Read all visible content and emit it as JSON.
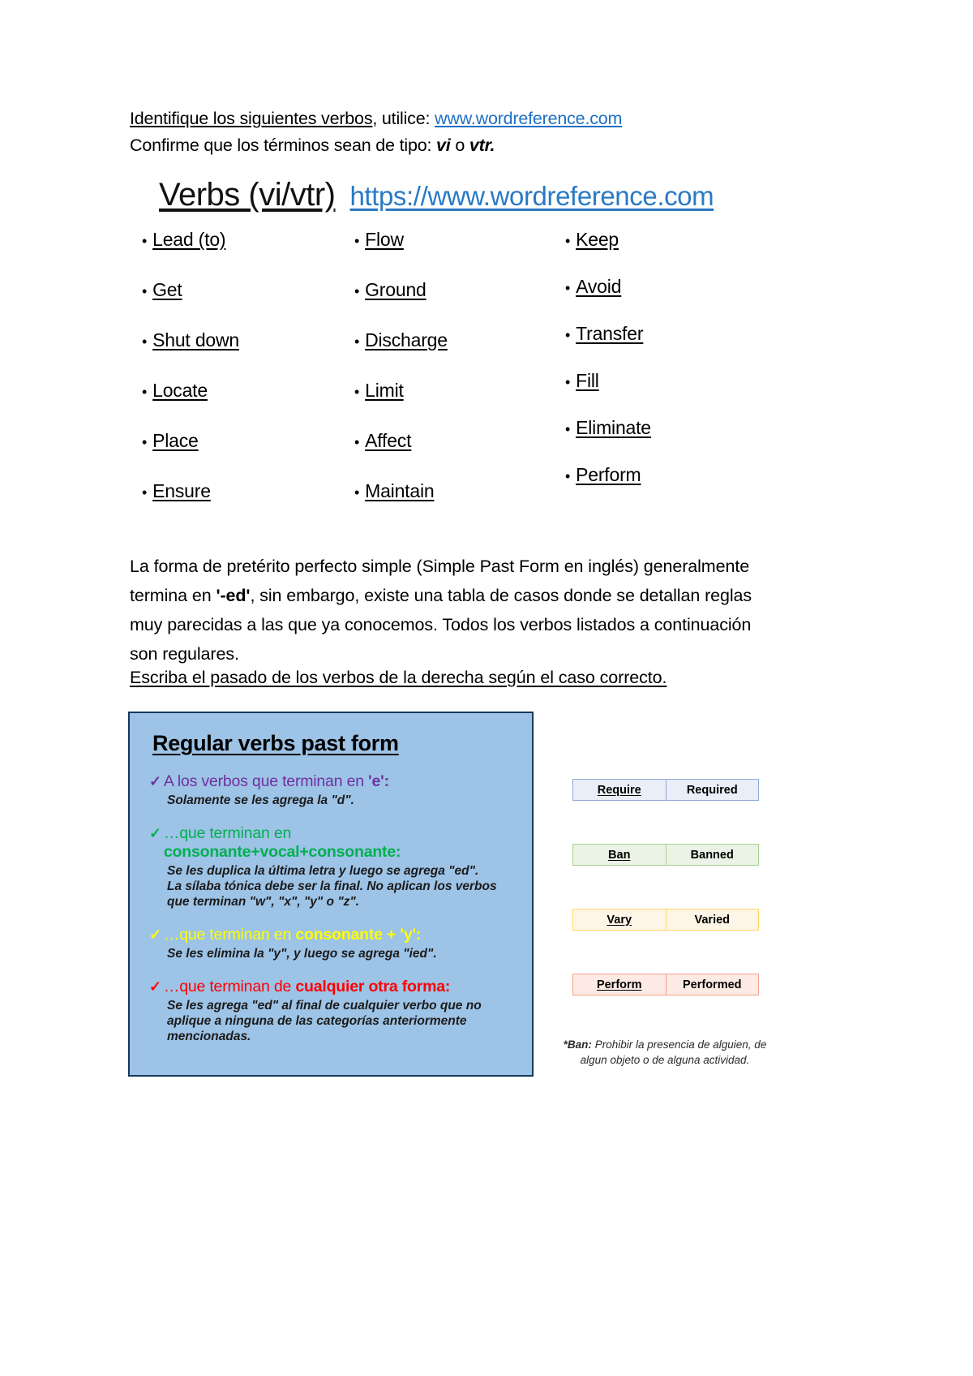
{
  "intro": {
    "line1_underlined": "Identifique los siguientes verbos",
    "line1_mid": ", utilice: ",
    "line1_link": "www.wordreference.com",
    "line2_a": "Confirme que los términos sean de tipo: ",
    "line2_vi": "vi",
    "line2_o": " o ",
    "line2_vtr": "vtr."
  },
  "verbs_header": {
    "title": "Verbs (vi/vtr)",
    "url": "https://www.wordreference.com"
  },
  "verb_columns": [
    {
      "items": [
        "Lead (to)",
        "Get",
        "Shut down",
        "Locate",
        "Place",
        "Ensure"
      ]
    },
    {
      "items": [
        "Flow",
        "Ground",
        "Discharge",
        "Limit",
        "Affect",
        "Maintain"
      ]
    },
    {
      "items": [
        "Keep",
        "Avoid",
        "Transfer",
        "Fill",
        "Eliminate",
        "Perform"
      ]
    }
  ],
  "paragraph": {
    "part1": "La forma de pretérito perfecto simple (Simple Past Form en inglés) generalmente termina en ",
    "bold1": "'-ed'",
    "part2": ", sin embargo, existe una tabla de casos donde se detallan reglas muy parecidas a las que ya conocemos. Todos los verbos listados a continuación son regulares.",
    "instruction": "Escriba el pasado de los verbos de la derecha según el caso correcto."
  },
  "rules_panel": {
    "title": "Regular verbs past form",
    "rules": [
      {
        "check": "✓",
        "lead": "A los verbos que terminan en ",
        "emphasis": "'e':",
        "desc": "Solamente se les agrega la \"d\".",
        "color": "#7030a0"
      },
      {
        "check": "✓",
        "lead": "…que terminan en ",
        "emphasis": "consonante+vocal+consonante:",
        "desc": "Se les duplica la última letra y luego se agrega \"ed\".\nLa sílaba tónica debe ser la final. No aplican los verbos\nque terminan \"w\", \"x\", \"y\" o \"z\".",
        "color": "#00b050"
      },
      {
        "check": "✓",
        "lead": "…que terminan en ",
        "emphasis": "consonante + 'y':",
        "desc": "Se les elimina la \"y\", y luego se agrega \"ied\".",
        "color": "#ffff00"
      },
      {
        "check": "✓",
        "lead": "…que terminan de ",
        "emphasis": "cualquier otra forma:",
        "desc": "Se les agrega \"ed\" al final de cualquier verbo que no\naplique a ninguna de las categorías anteriormente\nmencionadas.",
        "color": "#ff0000"
      }
    ],
    "background": "#9dc3e6",
    "border": "#17375e"
  },
  "examples": [
    {
      "base": "Require",
      "past": "Required",
      "style": "blue"
    },
    {
      "base": "Ban",
      "past": "Banned",
      "style": "green"
    },
    {
      "base": "Vary",
      "past": "Varied",
      "style": "yellow"
    },
    {
      "base": "Perform",
      "past": "Performed",
      "style": "red"
    }
  ],
  "footnote": {
    "bold": "*Ban:",
    "text": " Prohibir la presencia de alguien, de algun objeto o de alguna actividad."
  }
}
